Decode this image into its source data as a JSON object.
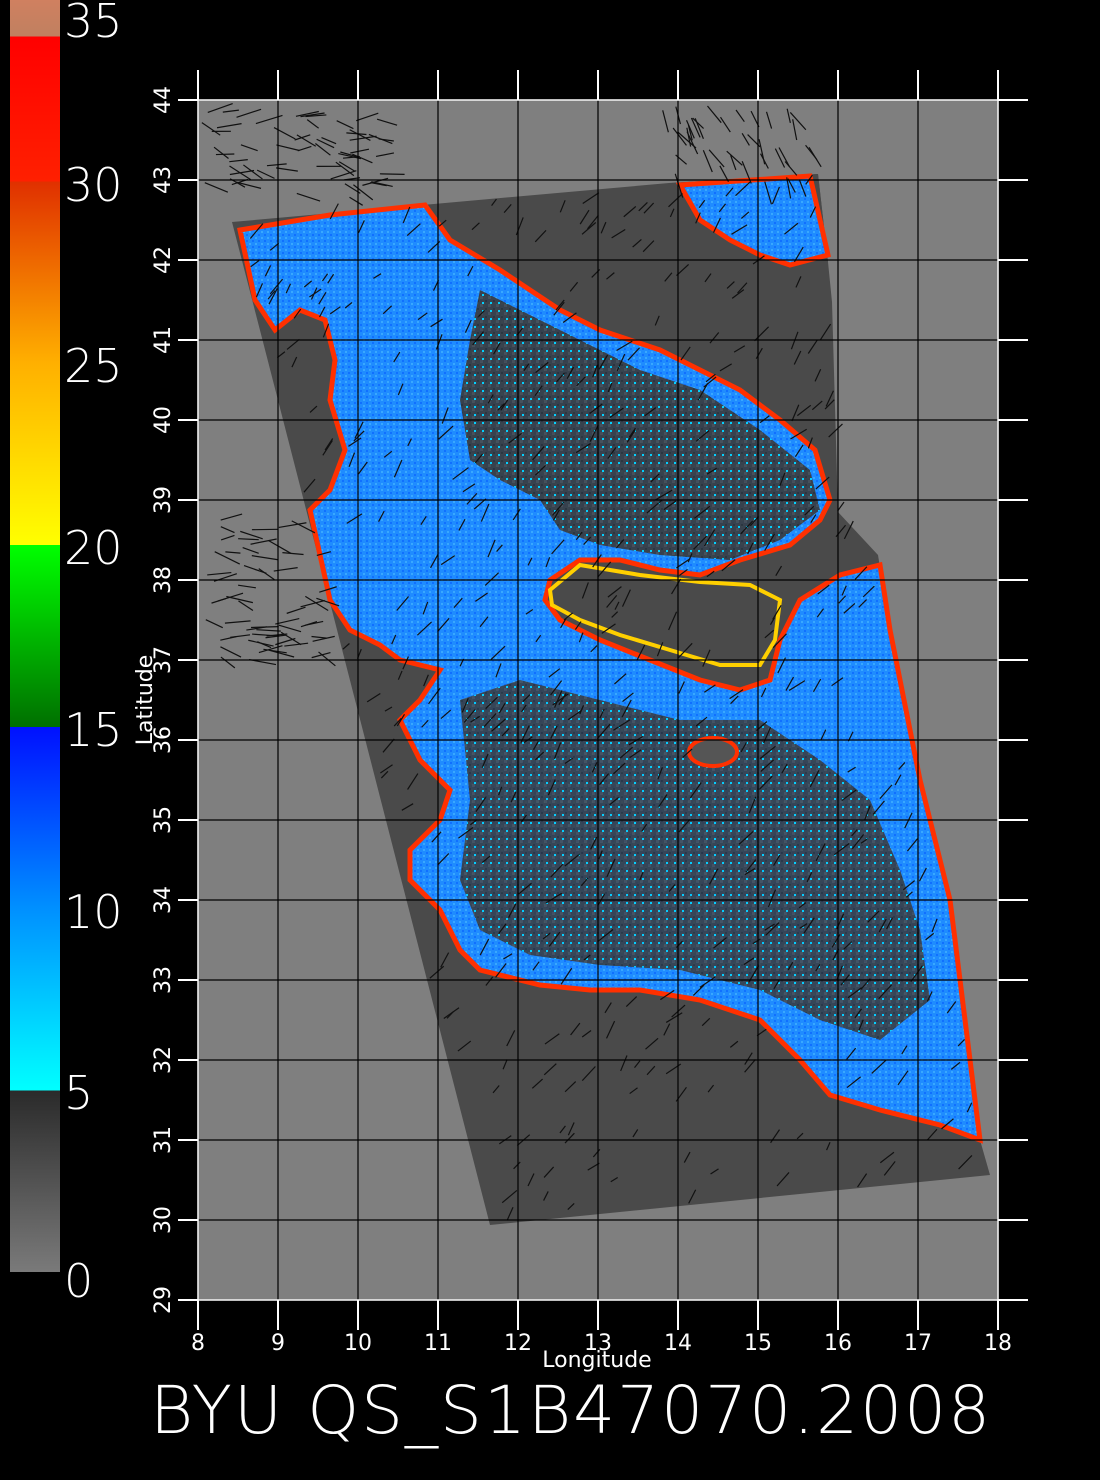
{
  "colorbar": {
    "labels": [
      "35",
      "30",
      "25",
      "20",
      "15",
      "10",
      "5",
      "0"
    ],
    "stops": [
      {
        "value": 0,
        "color": "#7a7a7a"
      },
      {
        "value": 5,
        "color": "#2a2a2a"
      },
      {
        "value": 5,
        "color": "#00ffff"
      },
      {
        "value": 10,
        "color": "#0090ff"
      },
      {
        "value": 15,
        "color": "#0010ff"
      },
      {
        "value": 15,
        "color": "#007000"
      },
      {
        "value": 20,
        "color": "#00ff00"
      },
      {
        "value": 20,
        "color": "#ffff00"
      },
      {
        "value": 25,
        "color": "#ffb000"
      },
      {
        "value": 30,
        "color": "#e03000"
      },
      {
        "value": 30,
        "color": "#ff2000"
      },
      {
        "value": 34,
        "color": "#ff0000"
      },
      {
        "value": 34,
        "color": "#c08060"
      },
      {
        "value": 35,
        "color": "#d08060"
      }
    ]
  },
  "map": {
    "lon_range": [
      8,
      18
    ],
    "lat_range": [
      29,
      44
    ],
    "lon_ticks": [
      "8",
      "9",
      "10",
      "11",
      "12",
      "13",
      "14",
      "15",
      "16",
      "17",
      "18"
    ],
    "lat_ticks": [
      "29",
      "30",
      "31",
      "32",
      "33",
      "34",
      "35",
      "36",
      "37",
      "38",
      "39",
      "40",
      "41",
      "42",
      "43",
      "44"
    ],
    "xlabel": "Longitude",
    "ylabel": "Latitude",
    "colors": {
      "background": "#7f7f7f",
      "swath": "#4a4a4a",
      "sea": "#1a8cff",
      "land": "#3a3a3a",
      "grid": "#000000",
      "coast_edge": "#ff3000"
    }
  },
  "footer": {
    "title": "BYU  QS_S1B47070.2008"
  }
}
